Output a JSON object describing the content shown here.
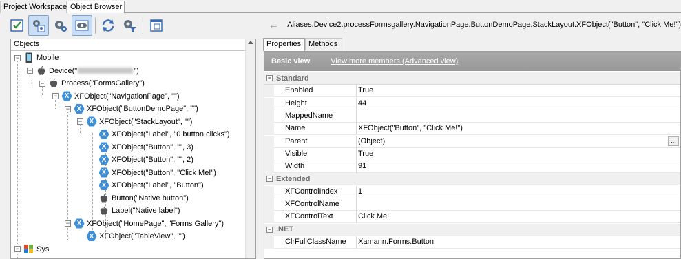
{
  "top_tabs": [
    "Project Workspace",
    "Object Browser"
  ],
  "toolbar": {
    "icons": [
      "checklist-icon",
      "object-spy-icon",
      "gear-icon",
      "eye-icon",
      "refresh-icon",
      "filter-gear-icon",
      "window-icon"
    ]
  },
  "left": {
    "header": "Objects",
    "tree": [
      {
        "label": "Mobile",
        "icon": "mobile-icon",
        "level": 0,
        "expander": "−"
      },
      {
        "label_pre": "Device(\"",
        "label_post": "\")",
        "icon": "apple-icon",
        "level": 1,
        "expander": "−",
        "blurred": true
      },
      {
        "label": "Process(\"FormsGallery\")",
        "icon": "apple-icon",
        "level": 2,
        "expander": "−"
      },
      {
        "label": "XFObject(\"NavigationPage\", \"\")",
        "icon": "xf-icon",
        "level": 3,
        "expander": "−"
      },
      {
        "label": "XFObject(\"ButtonDemoPage\", \"\")",
        "icon": "xf-icon",
        "level": 4,
        "expander": "−"
      },
      {
        "label": "XFObject(\"StackLayout\", \"\")",
        "icon": "xf-icon",
        "level": 5,
        "expander": "−"
      },
      {
        "label": "XFObject(\"Label\", \"0 button clicks\")",
        "icon": "xf-icon",
        "level": 6
      },
      {
        "label": "XFObject(\"Button\", \"\", 3)",
        "icon": "xf-icon",
        "level": 6
      },
      {
        "label": "XFObject(\"Button\", \"\", 2)",
        "icon": "xf-icon",
        "level": 6
      },
      {
        "label": "XFObject(\"Button\", \"Click Me!\")",
        "icon": "xf-icon",
        "level": 6
      },
      {
        "label": "XFObject(\"Label\", \"Button\")",
        "icon": "xf-icon",
        "level": 6
      },
      {
        "label": "Button(\"Native button\")",
        "icon": "apple-icon",
        "level": 6
      },
      {
        "label": "Label(\"Native label\")",
        "icon": "apple-icon",
        "level": 6
      },
      {
        "label": "XFObject(\"HomePage\", \"Forms Gallery\")",
        "icon": "xf-icon",
        "level": 4,
        "expander": "−"
      },
      {
        "label": "XFObject(\"TableView\", \"\")",
        "icon": "xf-icon",
        "level": 5
      },
      {
        "label": "Sys",
        "icon": "windows-icon",
        "level": 0,
        "expander": "−"
      }
    ]
  },
  "right": {
    "path": "Aliases.Device2.processFormsgallery.NavigationPage.ButtonDemoPage.StackLayout.XFObject(\"Button\", \"Click Me!\")",
    "tabs": [
      "Properties",
      "Methods"
    ],
    "basic_view": "Basic view",
    "advanced_link": "View more members (Advanced view)",
    "sections": [
      {
        "title": "Standard",
        "rows": [
          {
            "name": "Enabled",
            "value": "True"
          },
          {
            "name": "Height",
            "value": "44"
          },
          {
            "name": "MappedName",
            "value": ""
          },
          {
            "name": "Name",
            "value": "XFObject(\"Button\", \"Click Me!\")"
          },
          {
            "name": "Parent",
            "value": "(Object)",
            "has_button": true
          },
          {
            "name": "Visible",
            "value": "True"
          },
          {
            "name": "Width",
            "value": "91"
          }
        ]
      },
      {
        "title": "Extended",
        "rows": [
          {
            "name": "XFControlIndex",
            "value": "1"
          },
          {
            "name": "XFControlName",
            "value": ""
          },
          {
            "name": "XFControlText",
            "value": "Click Me!"
          }
        ]
      },
      {
        "title": ".NET",
        "rows": [
          {
            "name": "ClrFullClassName",
            "value": "Xamarin.Forms.Button"
          }
        ]
      }
    ],
    "ellipsis": "..."
  }
}
